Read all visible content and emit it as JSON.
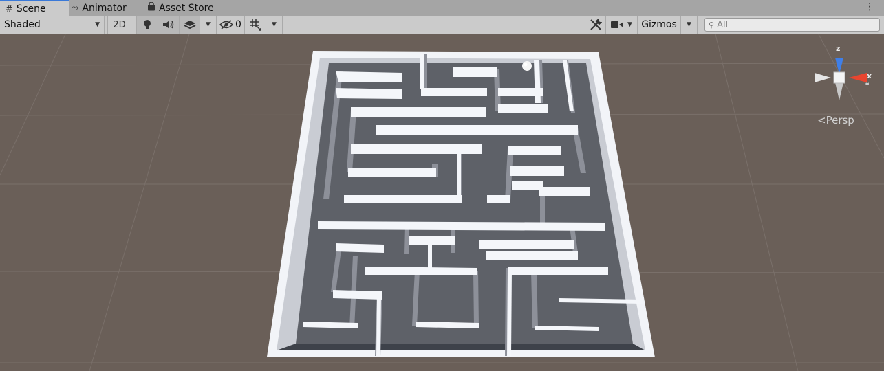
{
  "tabs": [
    {
      "label": "Scene",
      "icon": "grid-icon",
      "active": true
    },
    {
      "label": "Animator",
      "icon": "animator-icon",
      "active": false
    },
    {
      "label": "Asset Store",
      "icon": "bag-icon",
      "active": false
    }
  ],
  "toolbar": {
    "draw_mode": "Shaded",
    "toggle_2d": "2D",
    "hidden_count": "0",
    "gizmos": "Gizmos",
    "search_placeholder": "All"
  },
  "orientation_gizmo": {
    "z_label": "z",
    "x_label": "x",
    "projection": "Persp",
    "colors": {
      "x": "#e8452f",
      "z": "#3f7fe8",
      "neutral": "#e6e6e6"
    }
  }
}
